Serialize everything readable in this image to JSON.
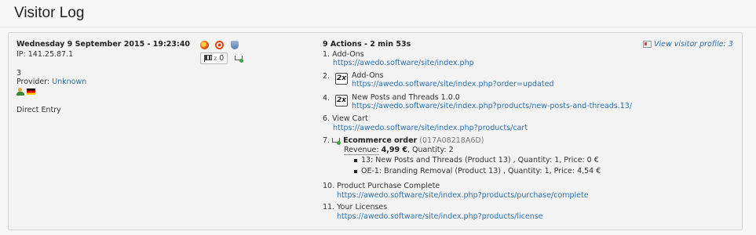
{
  "page": {
    "title": "Visitor Log"
  },
  "visit": {
    "datetime": "Wednesday 9 September 2015 - 19:23:40",
    "ip": "IP: 141.25.87.1",
    "visitor_number": "3",
    "provider_label": "Provider:",
    "provider_value": "Unknown",
    "referrer": "Direct Entry",
    "browser_icon": "firefox-icon",
    "os_icon": "ubuntu-icon",
    "plugin_icon": "plugin-icon",
    "goals_count": "0",
    "summary": "9 Actions - 2 min 53s",
    "profile_link": "View visitor profile: 3"
  },
  "actions": [
    {
      "index": "1.",
      "title": "Add-Ons",
      "url": "https://awedo.software/site/index.php",
      "repeat": ""
    },
    {
      "index": "2.",
      "title": "Add-Ons",
      "url": "https://awedo.software/site/index.php?order=updated",
      "repeat": "2x"
    },
    {
      "index": "4.",
      "title": "New Posts and Threads 1.0.0",
      "url": "https://awedo.software/site/index.php?products/new-posts-and-threads.13/",
      "repeat": "2x"
    },
    {
      "index": "6.",
      "title": "View Cart",
      "url": "https://awedo.software/site/index.php?products/cart",
      "repeat": ""
    },
    {
      "index": "10.",
      "title": "Product Purchase Complete",
      "url": "https://awedo.software/site/index.php?products/purchase/complete",
      "repeat": ""
    },
    {
      "index": "11.",
      "title": "Your Licenses",
      "url": "https://awedo.software/site/index.php?products/license",
      "repeat": ""
    }
  ],
  "ecommerce": {
    "index": "7.",
    "title": "Ecommerce order",
    "order_id": "(017A08218A6D)",
    "revenue_label": "Revenue:",
    "revenue_value": "4,99 €",
    "quantity": ", Quantity: 2",
    "items": [
      "13: New Posts and Threads (Product 13) , Quantity: 1, Price: 0 €",
      "OE-1: Branding Removal (Product 13) , Quantity: 1, Price: 4,54 €"
    ]
  },
  "colors": {
    "link": "#2a71b0",
    "background": "#f7f7f7",
    "card": "#f3f3f3"
  }
}
